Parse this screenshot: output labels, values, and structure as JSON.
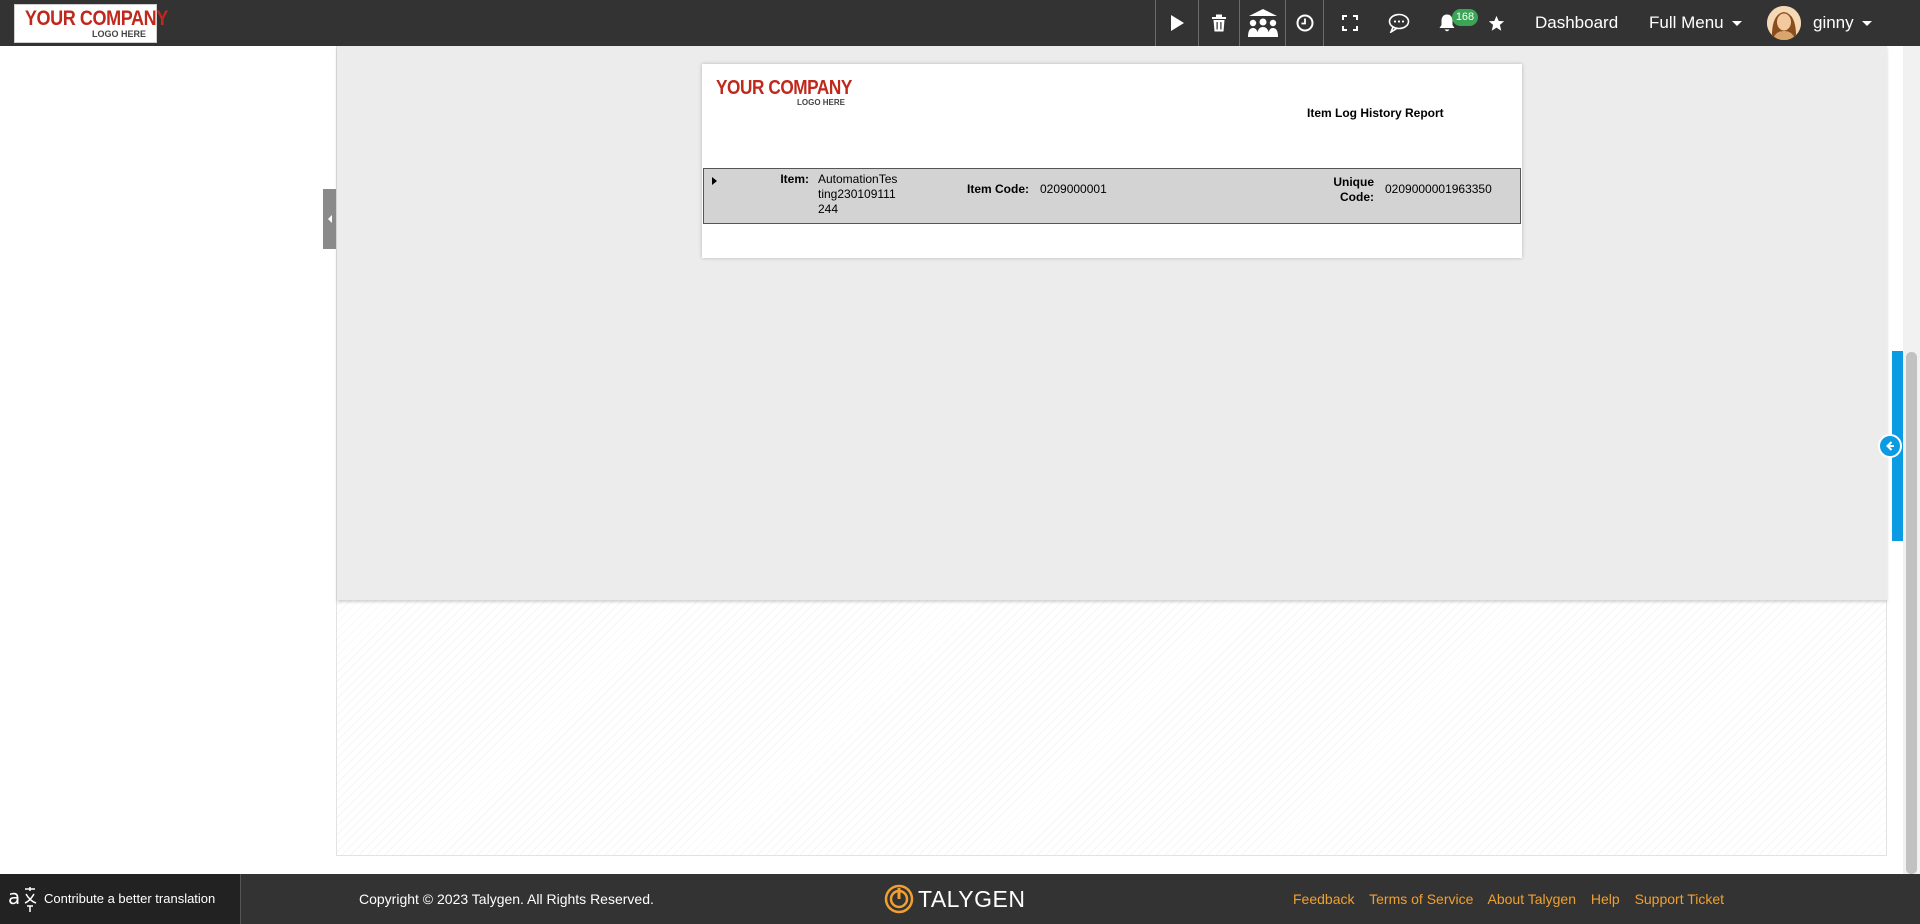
{
  "topbar": {
    "logo": {
      "main": "YOUR COMPANY",
      "sub": "LOGO HERE"
    },
    "icons": [
      "play-icon",
      "trash-icon",
      "group-meeting-icon",
      "clock-icon",
      "fullscreen-icon",
      "chat-icon",
      "bell-icon",
      "star-icon"
    ],
    "notification_count": "168",
    "dashboard_label": "Dashboard",
    "full_menu_label": "Full Menu",
    "user_name": "ginny"
  },
  "report": {
    "logo": {
      "main": "YOUR COMPANY",
      "sub": "LOGO HERE"
    },
    "title": "Item Log History Report",
    "row": {
      "item_label": "Item:",
      "item_value_lines": [
        "AutomationTes",
        "ting230109111",
        "244"
      ],
      "item_code_label": "Item Code:",
      "item_code_value": "0209000001",
      "unique_code_label_lines": [
        "Unique",
        "Code:"
      ],
      "unique_code_value": "0209000001963350"
    }
  },
  "footer": {
    "translate_label": "Contribute a better translation",
    "copyright": "Copyright © 2023 Talygen. All Rights Reserved.",
    "brand": "TALYGEN",
    "links": [
      "Feedback",
      "Terms of Service",
      "About Talygen",
      "Help",
      "Support Ticket"
    ],
    "link_color": "#f0a030"
  },
  "colors": {
    "topbar_bg": "#333333",
    "accent_blue": "#0a9be3",
    "badge_green": "#3aa556",
    "logo_red": "#c0281c"
  }
}
